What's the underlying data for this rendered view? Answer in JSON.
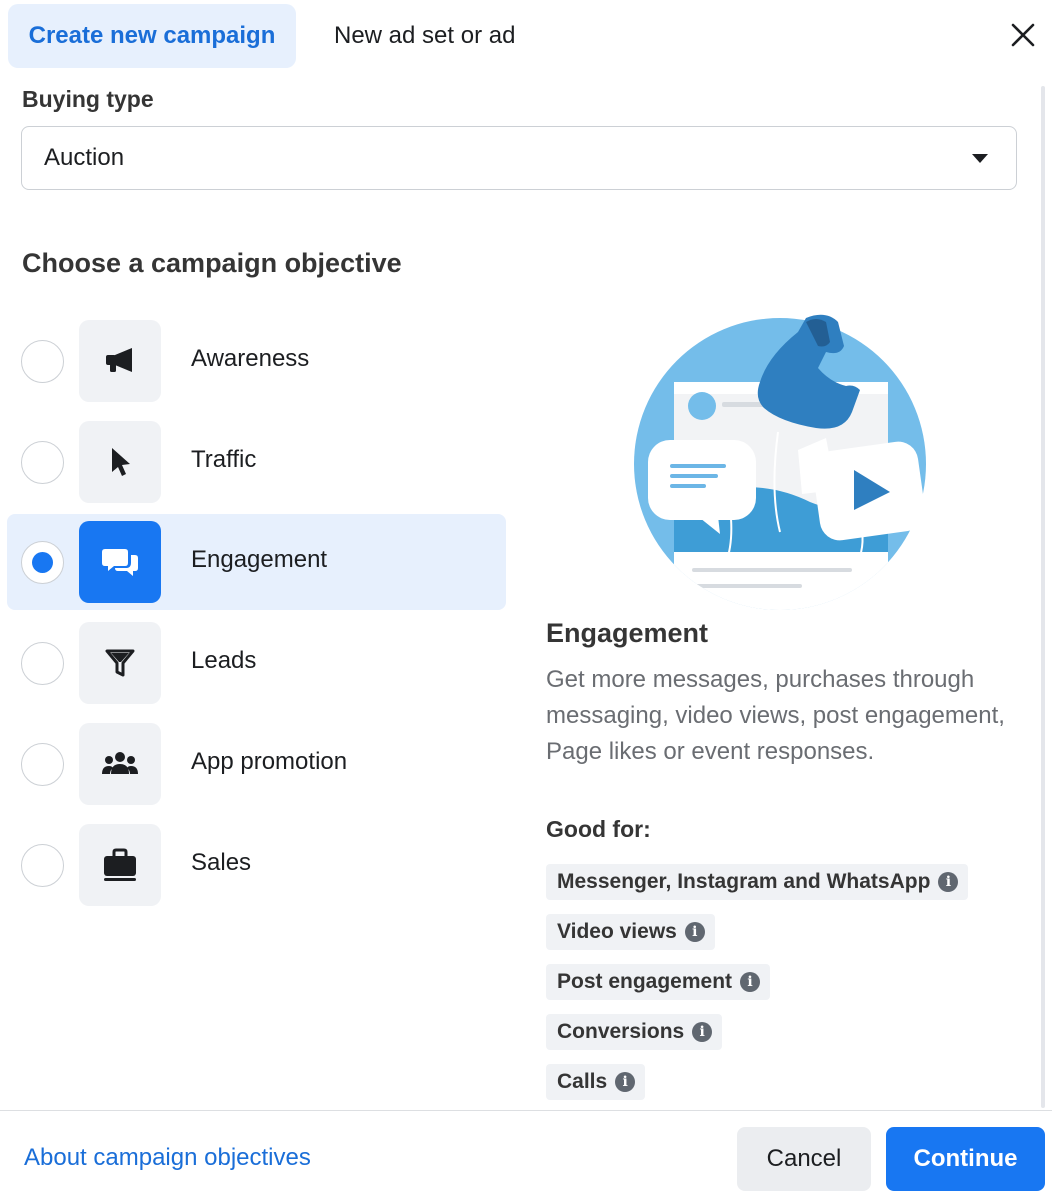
{
  "tabs": {
    "active": "Create new campaign",
    "inactive": "New ad set or ad"
  },
  "buying_type": {
    "label": "Buying type",
    "value": "Auction"
  },
  "objective": {
    "title": "Choose a campaign objective",
    "options": [
      {
        "label": "Awareness",
        "icon": "megaphone-icon",
        "selected": false
      },
      {
        "label": "Traffic",
        "icon": "cursor-icon",
        "selected": false
      },
      {
        "label": "Engagement",
        "icon": "chat-bubbles-icon",
        "selected": true
      },
      {
        "label": "Leads",
        "icon": "funnel-icon",
        "selected": false
      },
      {
        "label": "App promotion",
        "icon": "people-group-icon",
        "selected": false
      },
      {
        "label": "Sales",
        "icon": "briefcase-icon",
        "selected": false
      }
    ]
  },
  "detail": {
    "title": "Engagement",
    "description": "Get more messages, purchases through messaging, video views, post engagement, Page likes or event responses.",
    "good_for_label": "Good for:",
    "good_for": [
      "Messenger, Instagram and WhatsApp",
      "Video views",
      "Post engagement",
      "Conversions",
      "Calls"
    ]
  },
  "footer": {
    "about_link": "About campaign objectives",
    "cancel": "Cancel",
    "continue": "Continue"
  },
  "colors": {
    "accent": "#1877f2",
    "selected_bg": "#e7f0fd",
    "link": "#1a6ed8"
  }
}
